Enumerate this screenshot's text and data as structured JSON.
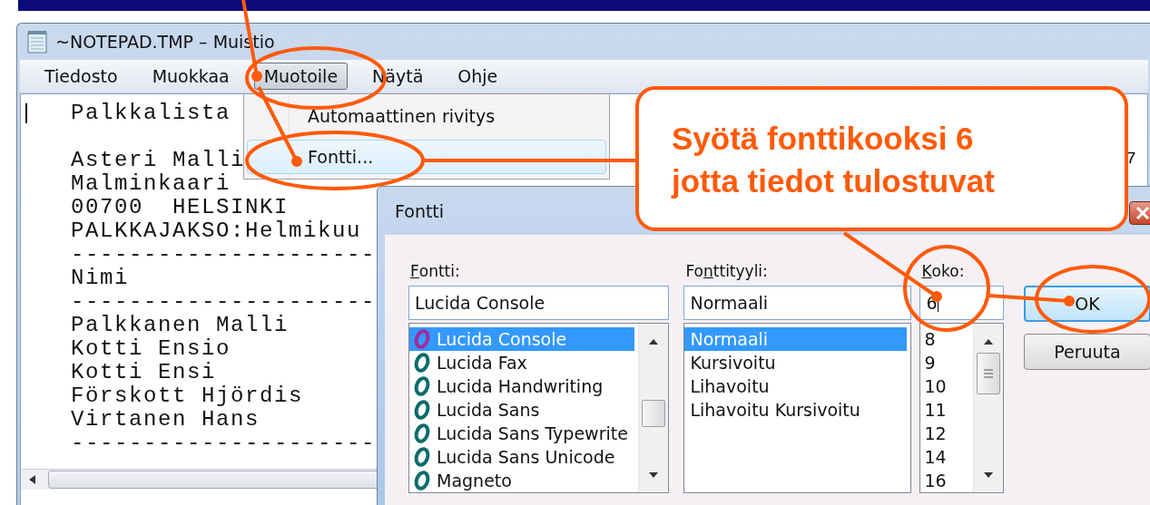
{
  "window": {
    "title": "~NOTEPAD.TMP – Muistio"
  },
  "menu_bar": [
    {
      "label": "Tiedosto",
      "selected": false
    },
    {
      "label": "Muokkaa",
      "selected": false
    },
    {
      "label": "Muotoile",
      "selected": true
    },
    {
      "label": "Näytä",
      "selected": false
    },
    {
      "label": "Ohje",
      "selected": false
    }
  ],
  "editor": {
    "blocks": [
      [
        "Palkkalista"
      ],
      [
        "Asteri Malli",
        "Malminkaari",
        "00700  HELSINKI",
        "PALKKAJAKSO:Helmikuu",
        "---------------------",
        "Nimi",
        "---------------------",
        "Palkkanen Malli",
        "Kotti Ensio",
        "Kotti Ensi",
        "Förskott Hjördis",
        "Virtanen Hans",
        "---------------------"
      ]
    ],
    "right_text": "7"
  },
  "format_menu": {
    "items": [
      {
        "label": "Automaattinen rivitys",
        "selected": false
      },
      {
        "label": "Fontti...",
        "selected": true
      }
    ]
  },
  "font_dialog": {
    "title": "Fontti",
    "font": {
      "label": {
        "key": "F",
        "after": "ontti:"
      },
      "value": "Lucida Console",
      "items": [
        {
          "label": "Lucida Console",
          "selected": true
        },
        {
          "label": "Lucida Fax",
          "selected": false
        },
        {
          "label": "Lucida Handwriting",
          "selected": false
        },
        {
          "label": "Lucida Sans",
          "selected": false
        },
        {
          "label": "Lucida Sans Typewrite",
          "selected": false
        },
        {
          "label": "Lucida Sans Unicode",
          "selected": false
        },
        {
          "label": "Magneto",
          "selected": false
        }
      ]
    },
    "style": {
      "label": {
        "before": "Fo",
        "key": "n",
        "after": "ttityyli:"
      },
      "value": "Normaali",
      "items": [
        {
          "label": "Normaali",
          "selected": true
        },
        {
          "label": "Kursivoitu",
          "selected": false
        },
        {
          "label": "Lihavoitu",
          "selected": false
        },
        {
          "label": "Lihavoitu Kursivoitu",
          "selected": false
        }
      ]
    },
    "size": {
      "label": {
        "key": "K",
        "after": "oko:"
      },
      "value": "6",
      "items": [
        {
          "label": "8",
          "selected": false
        },
        {
          "label": "9",
          "selected": false
        },
        {
          "label": "10",
          "selected": false
        },
        {
          "label": "11",
          "selected": false
        },
        {
          "label": "12",
          "selected": false
        },
        {
          "label": "14",
          "selected": false
        },
        {
          "label": "16",
          "selected": false
        }
      ]
    },
    "buttons": [
      {
        "label": "OK",
        "focused": true
      },
      {
        "label": "Peruuta",
        "focused": false
      }
    ]
  },
  "callout": {
    "lines": [
      "Syötä fonttikooksi 6",
      "jotta tiedot tulostuvat"
    ]
  }
}
